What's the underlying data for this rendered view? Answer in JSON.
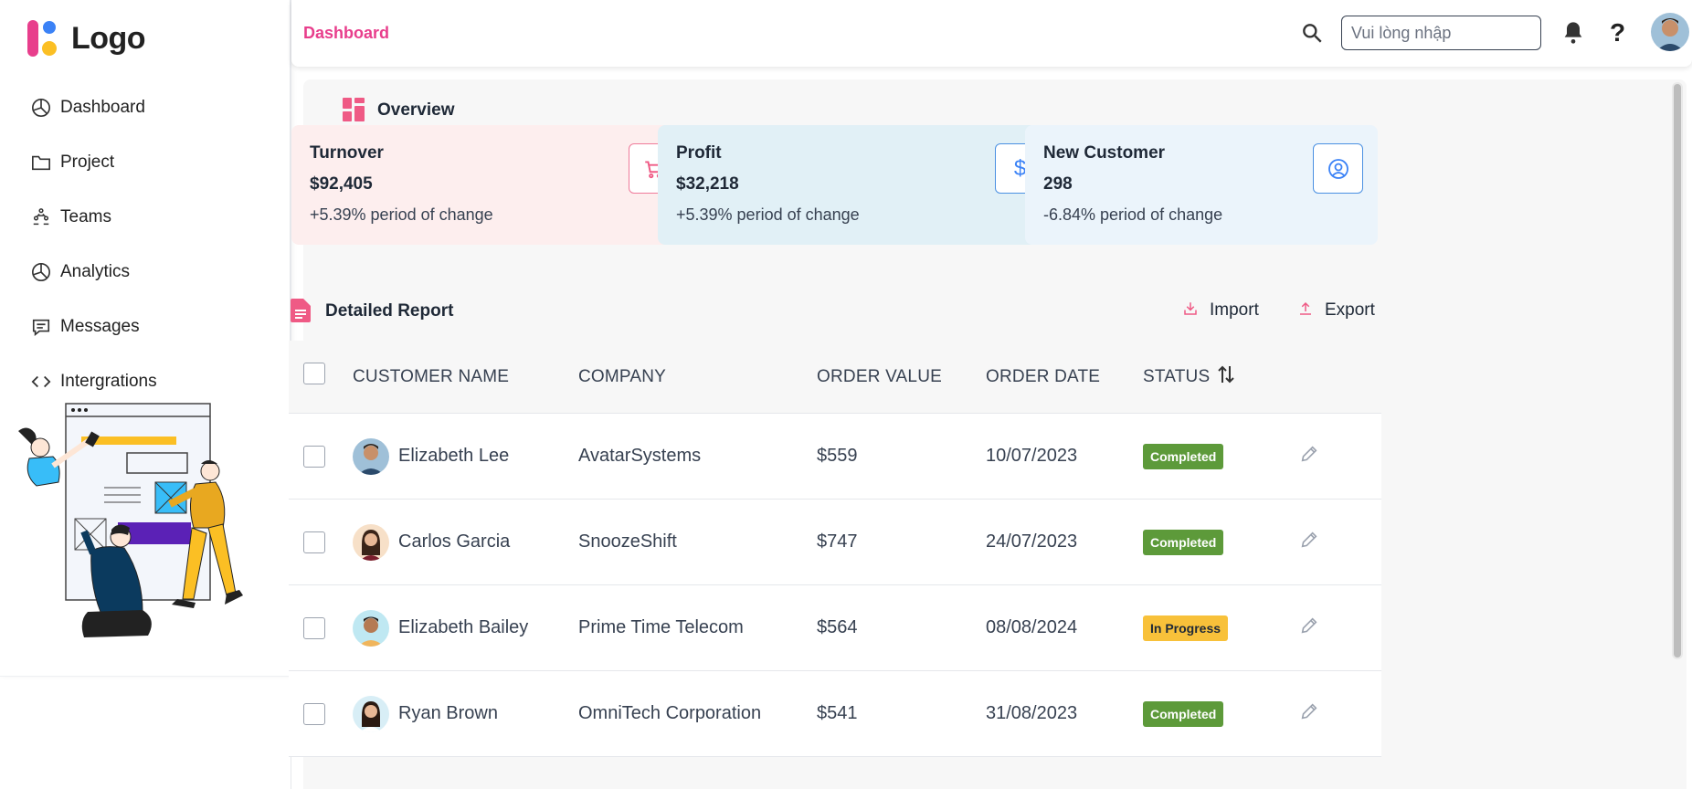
{
  "app": {
    "logo_text": "Logo"
  },
  "sidebar": {
    "items": [
      {
        "label": "Dashboard",
        "icon": "pie-chart-icon"
      },
      {
        "label": "Project",
        "icon": "folder-icon"
      },
      {
        "label": "Teams",
        "icon": "teams-icon"
      },
      {
        "label": "Analytics",
        "icon": "pie-chart-icon"
      },
      {
        "label": "Messages",
        "icon": "message-icon"
      },
      {
        "label": "Intergrations",
        "icon": "code-icon"
      }
    ]
  },
  "header": {
    "breadcrumb": "Dashboard",
    "search_placeholder": "Vui lòng nhập",
    "help_label": "?"
  },
  "overview": {
    "title": "Overview",
    "cards": [
      {
        "title": "Turnover",
        "value": "$92,405",
        "change": "+5.39% period of change",
        "icon": "cart-icon"
      },
      {
        "title": "Profit",
        "value": "$32,218",
        "change": "+5.39% period of change",
        "icon": "dollar-icon"
      },
      {
        "title": "New Customer",
        "value": "298",
        "change": "-6.84% period of change",
        "icon": "user-circle-icon"
      }
    ]
  },
  "report": {
    "title": "Detailed Report",
    "import_label": "Import",
    "export_label": "Export",
    "columns": [
      "CUSTOMER NAME",
      "COMPANY",
      "ORDER VALUE",
      "ORDER DATE",
      "STATUS"
    ],
    "rows": [
      {
        "name": "Elizabeth Lee",
        "company": "AvatarSystems",
        "value": "$559",
        "date": "10/07/2023",
        "status": "Completed"
      },
      {
        "name": "Carlos Garcia",
        "company": "SnoozeShift",
        "value": "$747",
        "date": "24/07/2023",
        "status": "Completed"
      },
      {
        "name": "Elizabeth Bailey",
        "company": "Prime Time Telecom",
        "value": "$564",
        "date": "08/08/2024",
        "status": "In Progress"
      },
      {
        "name": "Ryan Brown",
        "company": "OmniTech Corporation",
        "value": "$541",
        "date": "31/08/2023",
        "status": "Completed"
      }
    ]
  },
  "colors": {
    "accent": "#e83e8c",
    "card_turnover_bg": "#fdeeee",
    "card_profit_bg": "#e1f0f6",
    "card_customer_bg": "#ebf4fb",
    "status_completed": "#5d9a3a",
    "status_in_progress": "#f8c13a"
  }
}
